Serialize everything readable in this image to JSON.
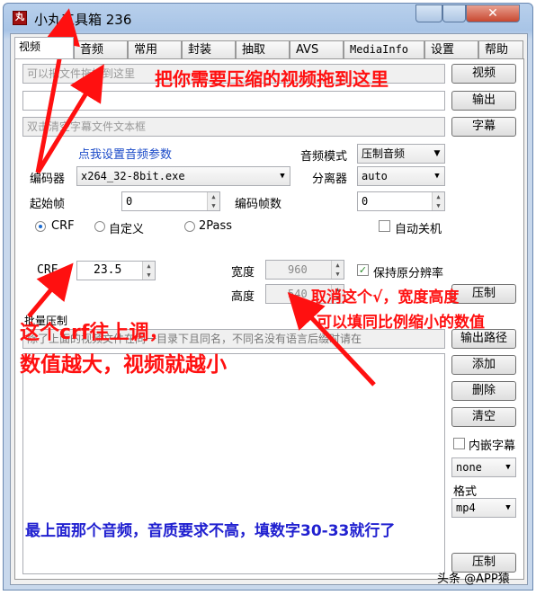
{
  "window": {
    "title": "小丸工具箱 236",
    "icon_text": "丸",
    "close_glyph": "✕"
  },
  "tabs": [
    "视频",
    "音频",
    "常用",
    "封装",
    "抽取",
    "AVS",
    "MediaInfo",
    "设置",
    "帮助"
  ],
  "selected_tab": "视频",
  "video_input": {
    "placeholder": "可以把文件拖拽到这里",
    "button": "视频"
  },
  "output": {
    "value": "",
    "button": "输出"
  },
  "subtitle": {
    "placeholder": "双击清空字幕文件文本框",
    "button": "字幕"
  },
  "audio_settings_link": "点我设置音频参数",
  "audio_mode": {
    "label": "音频模式",
    "value": "压制音频"
  },
  "encoder": {
    "label": "编码器",
    "value": "x264_32-8bit.exe"
  },
  "splitter": {
    "label": "分离器",
    "value": "auto"
  },
  "start_frame": {
    "label": "起始帧",
    "value": "0"
  },
  "encode_frames": {
    "label": "编码帧数",
    "value": "0"
  },
  "rate_modes": [
    {
      "label": "CRF",
      "selected": true
    },
    {
      "label": "自定义",
      "selected": false
    },
    {
      "label": "2Pass",
      "selected": false
    }
  ],
  "auto_shutdown": {
    "label": "自动关机",
    "checked": false
  },
  "crf": {
    "label": "CRF",
    "value": "23.5"
  },
  "width": {
    "label": "宽度",
    "value": "960"
  },
  "height": {
    "label": "高度",
    "value": "540"
  },
  "keep_resolution": {
    "label": "保持原分辨率",
    "checked": true,
    "check_glyph": "✓"
  },
  "compress_button_top": "压制",
  "batch": {
    "label": "批量压制",
    "hint": "除了上面的视频文件在同一目录下且同名，不同名没有语言后缀时请在",
    "output_path_button": "输出路径",
    "add_button": "添加",
    "delete_button": "删除",
    "clear_button": "清空",
    "embed_subtitle_label": "内嵌字幕",
    "embed_subtitle_checked": false,
    "subtitle_select": "none",
    "format_label": "格式",
    "format_select": "mp4",
    "compress_button": "压制"
  },
  "annotations": {
    "drag_here": "把你需要压缩的视频拖到这里",
    "crf_tip_1": "这个crf往上调，",
    "crf_tip_2": "数值越大，视频就越小",
    "uncheck_tip_1": "取消这个√，宽度高度",
    "uncheck_tip_2": "可以填同比例缩小的数值",
    "audio_tip": "最上面那个音频，音质要求不高，填数字30-33就行了"
  },
  "watermark": "头条 @APP猿",
  "colors": {
    "annotation_red": "#ff1010",
    "annotation_blue": "#2020d0",
    "title_bar": "#b8d0ec"
  }
}
